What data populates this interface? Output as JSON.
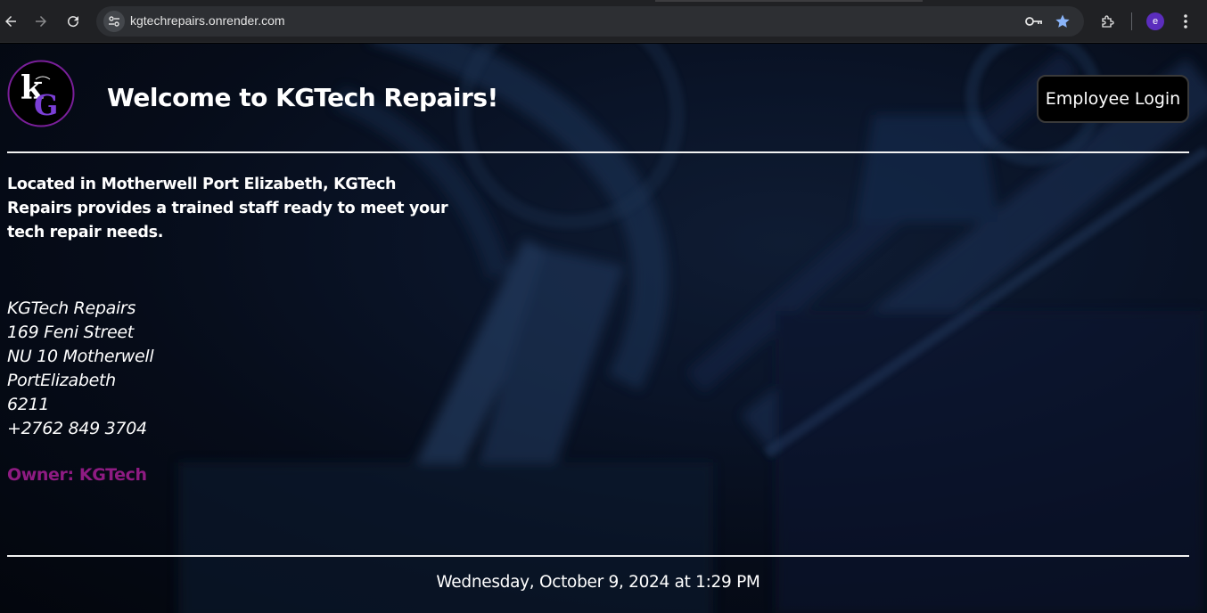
{
  "browser": {
    "url": "kgtechrepairs.onrender.com",
    "profile_initial": "e",
    "icons": [
      "back-arrow-icon",
      "forward-arrow-icon",
      "reload-icon",
      "site-settings-icon",
      "password-key-icon",
      "bookmark-star-icon",
      "extensions-icon",
      "more-menu-icon"
    ],
    "accent_color": "#8ab4f8"
  },
  "header": {
    "logo_text": "kG",
    "title": "Welcome to KGTech Repairs!",
    "login_label": "Employee Login"
  },
  "main": {
    "intro": "Located in Motherwell Port Elizabeth, KGTech Repairs provides a trained staff ready to meet your tech repair needs.",
    "address_lines": [
      "KGTech Repairs",
      "169 Feni Street",
      "NU 10 Motherwell",
      "PortElizabeth",
      "6211",
      "+2762 849 3704"
    ],
    "owner": "Owner: KGTech",
    "owner_color": "#8e1b82"
  },
  "footer": {
    "datetime": "Wednesday, October 9, 2024 at 1:29 PM"
  }
}
